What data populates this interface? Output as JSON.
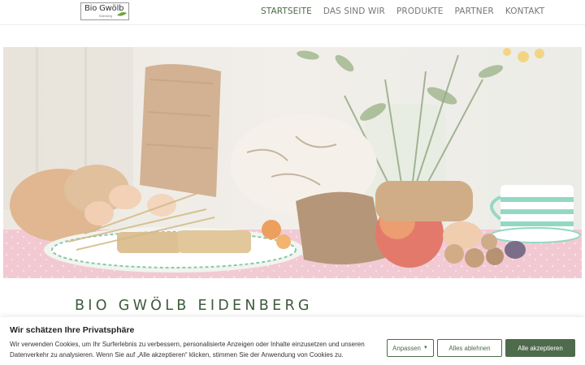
{
  "header": {
    "logo_text": "Bio Gwölb",
    "logo_subtext": "Eidenberg",
    "nav": [
      {
        "label": "STARTSEITE",
        "active": true
      },
      {
        "label": "DAS SIND WIR",
        "active": false
      },
      {
        "label": "PRODUKTE",
        "active": false
      },
      {
        "label": "PARTNER",
        "active": false
      },
      {
        "label": "KONTAKT",
        "active": false
      }
    ]
  },
  "main": {
    "site_title": "BIO GWÖLB EIDENBERG"
  },
  "cookie_banner": {
    "title": "Wir schätzen Ihre Privatsphäre",
    "text": "Wir verwenden Cookies, um Ihr Surferlebnis zu verbessern, personalisierte Anzeigen oder Inhalte einzusetzen und unseren Datenverkehr zu analysieren. Wenn Sie auf „Alle akzeptieren“ klicken, stimmen Sie der Anwendung von Cookies zu.",
    "customize_label": "Anpassen",
    "reject_label": "Alles ablehnen",
    "accept_label": "Alle akzeptieren"
  },
  "colors": {
    "brand_green": "#4e6b4b",
    "title_green": "#3d5b3a",
    "nav_gray": "#777777"
  }
}
